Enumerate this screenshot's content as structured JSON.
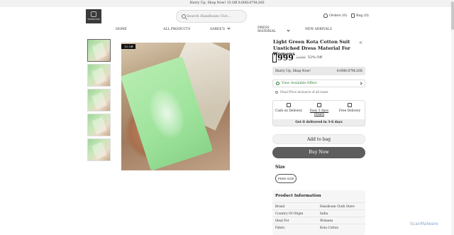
{
  "topbar": {
    "text": "Hurry Up, Shop Now! 15 Off  0:00H:07M:20S"
  },
  "header": {
    "logo_text": "HANDLOOM",
    "search_placeholder": "Search Handloom Clot...",
    "orders_label": "Orders (0)",
    "bag_label": "Bag (0)"
  },
  "nav": {
    "home": "HOME",
    "all_products": "ALL PRODUCTS",
    "sarees": "SAREE'S",
    "dress_material_1": "DRESS",
    "dress_material_2": "MATERIAL",
    "new_arrivals": "NEW ARRIVALS"
  },
  "gallery": {
    "off_tag": "15 Off"
  },
  "product": {
    "title": "Light Green Kota Cotton Suit Unstiched Dress Material For Womens",
    "price": "999",
    "mrp": "2,099",
    "discount": "52% Off"
  },
  "hurry": {
    "label": "Hurry Up, Shop Now!",
    "timer": "0:00H:07M:20S"
  },
  "offers": {
    "label": "View Available Offers"
  },
  "note": {
    "text": "Final Price inclusive of all taxes"
  },
  "features": {
    "cod": "Cash on Delivery",
    "returns": "Easy 3 days return",
    "free": "Free Delivery",
    "delivery": "Get it delivered in 3-6 days"
  },
  "buttons": {
    "add_to_bag": "Add to bag",
    "buy_now": "Buy Now"
  },
  "size": {
    "label": "Size",
    "option": "FREE SIZE"
  },
  "info": {
    "title": "Product Information",
    "rows": [
      {
        "k": "Brand",
        "v": "Handloom Cloth Store"
      },
      {
        "k": "Country Of Origin",
        "v": "India"
      },
      {
        "k": "Ideal For",
        "v": "Womens"
      },
      {
        "k": "Fabric",
        "v": "Kota Cotton"
      }
    ]
  },
  "watermark": "ScanMalware",
  "colors": {
    "accent_green": "#2e7d32",
    "buy_button": "#5d5d5d",
    "fabric_green": "#9ee39c"
  }
}
